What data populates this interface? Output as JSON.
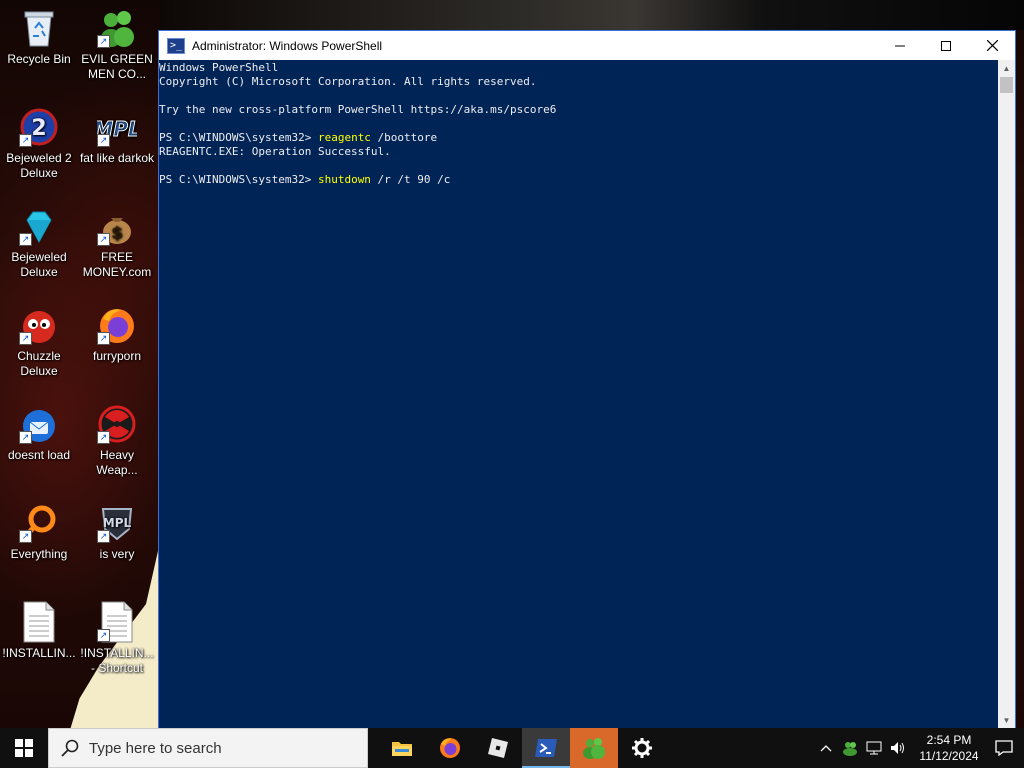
{
  "desktop": {
    "icons": [
      {
        "label": "Recycle Bin"
      },
      {
        "label": "EVIL GREEN\nMEN CO..."
      },
      {
        "label": "Bejeweled 2\nDeluxe"
      },
      {
        "label": "fat like darkok"
      },
      {
        "label": "Bejeweled\nDeluxe"
      },
      {
        "label": "FREE\nMONEY.com"
      },
      {
        "label": "Chuzzle\nDeluxe"
      },
      {
        "label": "furryporn"
      },
      {
        "label": "doesnt load"
      },
      {
        "label": "Heavy\nWeap..."
      },
      {
        "label": "Everything"
      },
      {
        "label": "is very"
      },
      {
        "label": "!INSTALLIN..."
      },
      {
        "label": "!INSTALLIN...\n- Shortcut"
      }
    ]
  },
  "window": {
    "title": "Administrator: Windows PowerShell",
    "console": {
      "lines": [
        {
          "text": "Windows PowerShell"
        },
        {
          "text": "Copyright (C) Microsoft Corporation. All rights reserved."
        },
        {
          "text": ""
        },
        {
          "text": "Try the new cross-platform PowerShell https://aka.ms/pscore6"
        },
        {
          "text": ""
        },
        {
          "prompt": "PS C:\\WINDOWS\\system32> ",
          "cmd": "reagentc",
          "args": " /boottore"
        },
        {
          "text": "REAGENTC.EXE: Operation Successful."
        },
        {
          "text": ""
        },
        {
          "prompt": "PS C:\\WINDOWS\\system32> ",
          "cmd": "shutdown",
          "args": " /r /t 90 /c"
        }
      ]
    }
  },
  "taskbar": {
    "search_placeholder": "Type here to search",
    "apps": [
      "file-explorer",
      "firefox",
      "roblox",
      "powershell",
      "green-men",
      "settings"
    ],
    "clock": {
      "time": "2:54 PM",
      "date": "11/12/2024"
    }
  },
  "colors": {
    "console_bg": "#012456",
    "console_text": "#eeedf0",
    "command": "#ffff00",
    "taskbar": "#101010"
  }
}
